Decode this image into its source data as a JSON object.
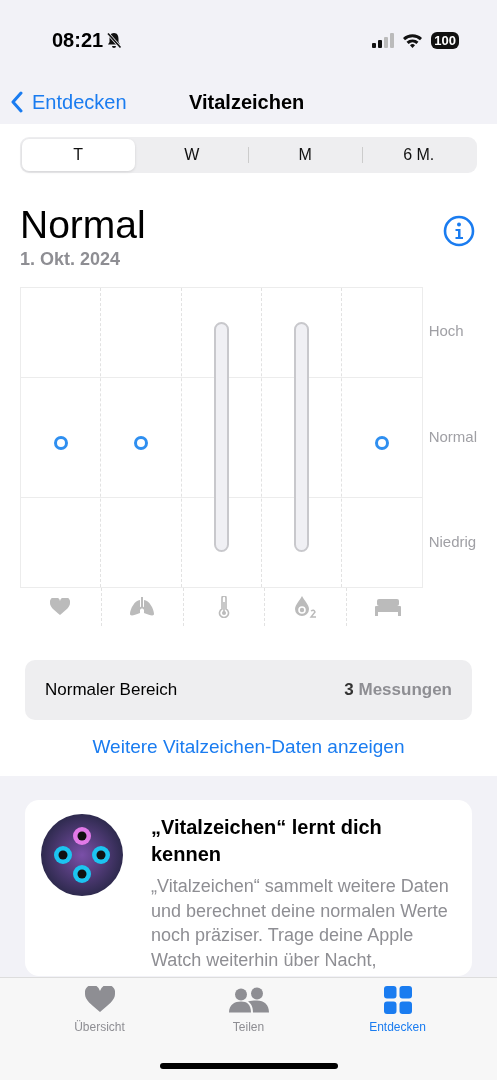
{
  "status_bar": {
    "time": "08:21",
    "battery": "100"
  },
  "nav": {
    "back": "Entdecken",
    "title": "Vitalzeichen"
  },
  "segments": [
    {
      "label": "T",
      "selected": true
    },
    {
      "label": "W",
      "selected": false
    },
    {
      "label": "M",
      "selected": false
    },
    {
      "label": "6 M.",
      "selected": false
    }
  ],
  "summary": {
    "status": "Normal",
    "date": "1. Okt. 2024"
  },
  "chart": {
    "bands": [
      "Hoch",
      "Normal",
      "Niedrig"
    ],
    "metrics": [
      {
        "kind": "dot"
      },
      {
        "kind": "dot"
      },
      {
        "kind": "range"
      },
      {
        "kind": "range"
      },
      {
        "kind": "dot"
      }
    ]
  },
  "normal_range": {
    "label": "Normaler Bereich",
    "count": "3",
    "unit": "Messungen"
  },
  "more_link": "Weitere Vitalzeichen-Daten anzeigen",
  "info_card": {
    "title": "„Vitalzeichen“ lernt dich kennen",
    "body": "„Vitalzeichen“ sammelt weitere Daten und berechnet deine normalen Werte noch präziser. Trage deine Apple Watch weiterhin über Nacht,"
  },
  "tab_bar": [
    {
      "label": "Übersicht",
      "selected": false
    },
    {
      "label": "Teilen",
      "selected": false
    },
    {
      "label": "Entdecken",
      "selected": true
    }
  ]
}
